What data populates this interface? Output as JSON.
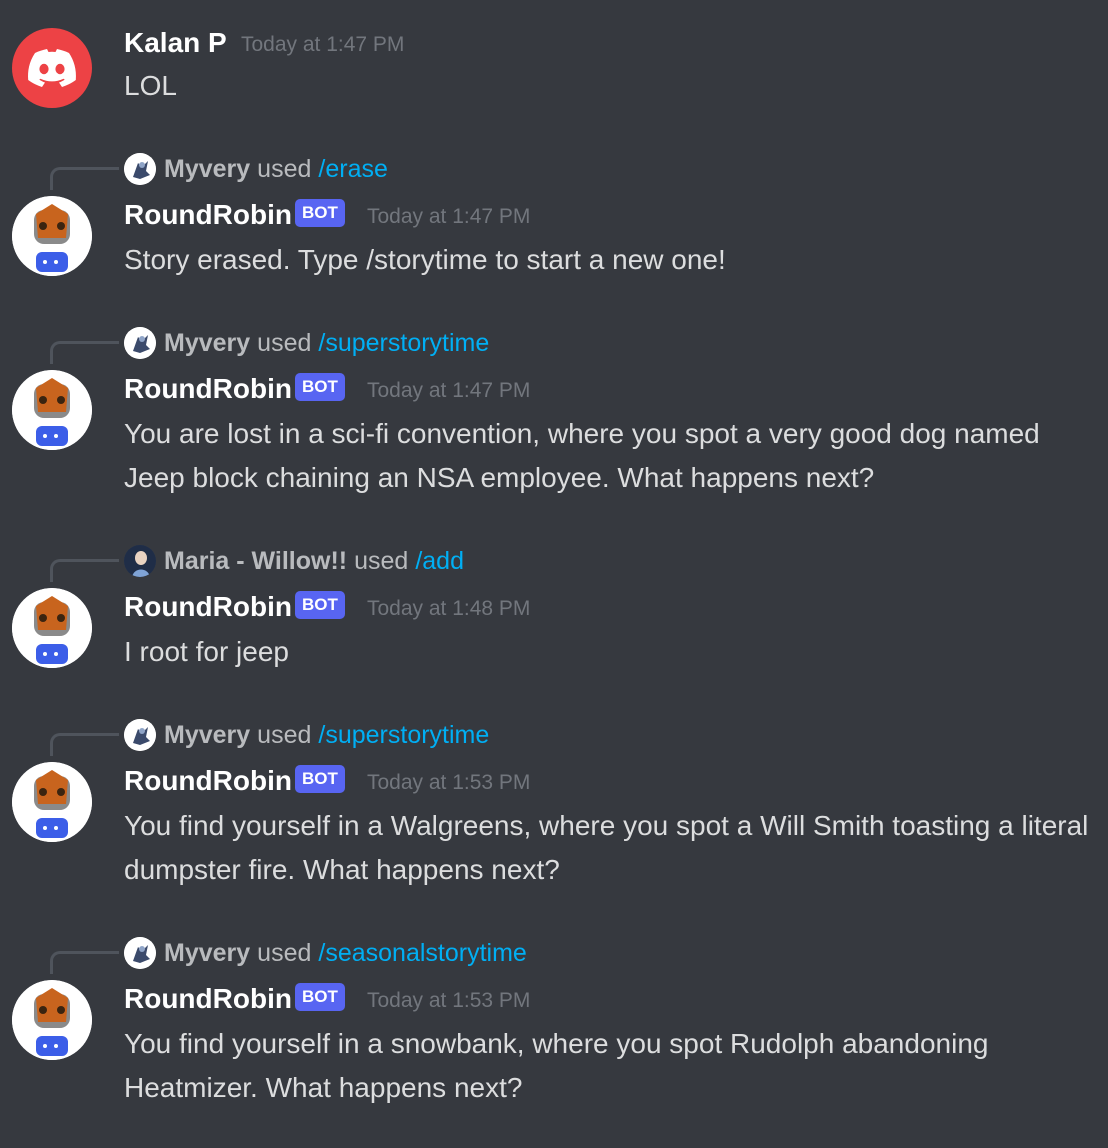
{
  "colors": {
    "background": "#36393f",
    "username": "#ffffff",
    "text": "#dcddde",
    "timestamp": "#72767d",
    "bot_tag": "#5865f2",
    "command": "#00aff4",
    "discord_red": "#ed4245"
  },
  "messages": [
    {
      "author": "Kalan P",
      "avatar_icon": "discord-logo-icon",
      "timestamp": "Today at 1:47 PM",
      "text": "LOL"
    },
    {
      "reply": {
        "user": "Myvery",
        "used": "used",
        "command": "/erase",
        "avatar_icon": "user-avatar-icon"
      },
      "author": "RoundRobin",
      "bot_tag": "BOT",
      "avatar_icon": "bot-avatar-icon",
      "timestamp": "Today at 1:47 PM",
      "text": "Story erased. Type /storytime to start a new one!"
    },
    {
      "reply": {
        "user": "Myvery",
        "used": "used",
        "command": "/superstorytime",
        "avatar_icon": "user-avatar-icon"
      },
      "author": "RoundRobin",
      "bot_tag": "BOT",
      "avatar_icon": "bot-avatar-icon",
      "timestamp": "Today at 1:47 PM",
      "text": "You are lost in a sci-fi convention, where you spot a very good dog named Jeep block chaining an NSA employee. What happens next?"
    },
    {
      "reply": {
        "user": "Maria - Willow!!",
        "used": "used",
        "command": "/add",
        "avatar_icon": "user-avatar-icon"
      },
      "author": "RoundRobin",
      "bot_tag": "BOT",
      "avatar_icon": "bot-avatar-icon",
      "timestamp": "Today at 1:48 PM",
      "text": "I root for jeep"
    },
    {
      "reply": {
        "user": "Myvery",
        "used": "used",
        "command": "/superstorytime",
        "avatar_icon": "user-avatar-icon"
      },
      "author": "RoundRobin",
      "bot_tag": "BOT",
      "avatar_icon": "bot-avatar-icon",
      "timestamp": "Today at 1:53 PM",
      "text": "You find yourself in a Walgreens, where you spot a Will Smith toasting a literal dumpster fire. What happens next?"
    },
    {
      "reply": {
        "user": "Myvery",
        "used": "used",
        "command": "/seasonalstorytime",
        "avatar_icon": "user-avatar-icon"
      },
      "author": "RoundRobin",
      "bot_tag": "BOT",
      "avatar_icon": "bot-avatar-icon",
      "timestamp": "Today at 1:53 PM",
      "text": "You find yourself in a snowbank, where you spot Rudolph abandoning Heatmizer. What happens next?"
    }
  ]
}
